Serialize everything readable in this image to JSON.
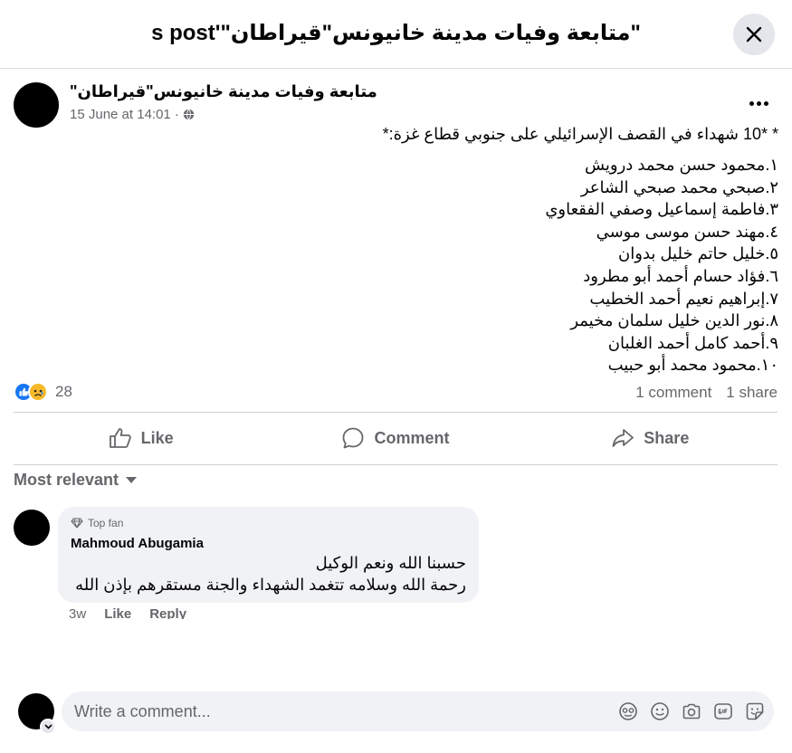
{
  "header": {
    "title": "\"متابعة وفيات مدينة خانيونس\"قيراطان\"'s post"
  },
  "post": {
    "page_name": "\"متابعة وفيات مدينة خانيونس\"قيراطان",
    "timestamp": "15 June at 14:01 ·",
    "privacy_icon": "globe-icon",
    "headline": "* *10 شهداء في القصف الإسرائيلي على جنوبي قطاع غزة:*",
    "names": [
      "١.محمود حسن محمد درويش",
      "٢.صبحي محمد صبحي الشاعر",
      "٣.فاطمة إسماعيل وصفي الفقعاوي",
      "٤.مهند حسن موسى موسي",
      "٥.خليل حاتم خليل بدوان",
      "٦.فؤاد حسام أحمد أبو مطرود",
      "٧.إبراهيم نعيم أحمد الخطيب",
      "٨.نور الدين خليل سلمان مخيمر",
      "٩.أحمد كامل أحمد الغلبان",
      "١٠.محمود محمد أبو حبيب"
    ],
    "reaction_count": "28",
    "comments_count": "1 comment",
    "shares_count": "1 share"
  },
  "actions": {
    "like": "Like",
    "comment": "Comment",
    "share": "Share"
  },
  "comments_section": {
    "sort_label": "Most relevant",
    "comment": {
      "badge": "Top fan",
      "author": "Mahmoud Abugamia",
      "line1": "حسبنا الله ونعم الوكيل",
      "line2": "رحمة الله وسلامه تتغمد الشهداء والجنة مستقرهم بإذن الله",
      "age": "3w",
      "like": "Like",
      "reply": "Reply"
    }
  },
  "composer": {
    "placeholder": "Write a comment..."
  },
  "colors": {
    "accent": "#1877f2",
    "muted_text": "#65676b",
    "bubble_bg": "#f0f2f5",
    "sad_reaction": "#f7b928"
  }
}
